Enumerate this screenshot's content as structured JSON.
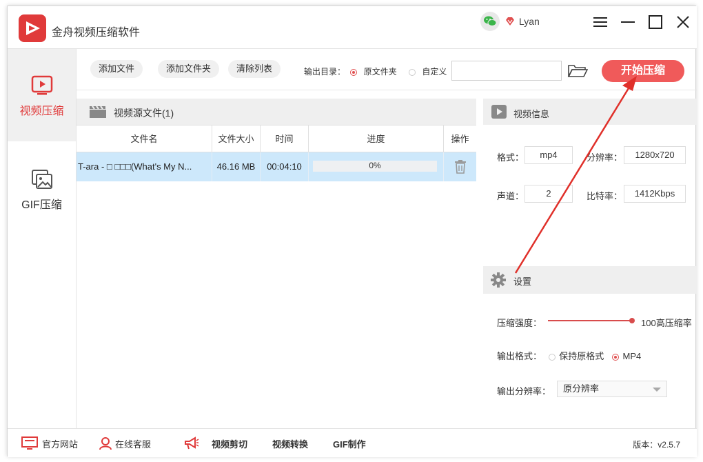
{
  "app": {
    "title": "金舟视频压缩软件",
    "username": "Lyan",
    "accent_color": "#f05a5a",
    "icons": [
      "app-logo-icon",
      "wechat-icon",
      "vip-icon",
      "menu-icon",
      "minimize-icon",
      "maximize-icon",
      "close-icon"
    ]
  },
  "sidebar": {
    "items": [
      {
        "label": "视频压缩",
        "icon": "video-play-icon",
        "active": true
      },
      {
        "label": "GIF压缩",
        "icon": "image-stack-icon",
        "active": false
      }
    ]
  },
  "toolbar": {
    "add_file": "添加文件",
    "add_folder": "添加文件夹",
    "clear_list": "清除列表",
    "output_dir_label": "输出目录：",
    "opt_original": "原文件夹",
    "opt_custom": "自定义",
    "path_value": "",
    "start_label": "开始压缩"
  },
  "source": {
    "title": "视频源文件(1)",
    "columns": [
      "文件名",
      "文件大小",
      "时间",
      "进度",
      "操作"
    ],
    "rows": [
      {
        "name": "T-ara - □ □□□(What's My N...",
        "size": "46.16 MB",
        "duration": "00:04:10",
        "progress": "0%"
      }
    ]
  },
  "info": {
    "title": "视频信息",
    "format_label": "格式：",
    "format_value": "mp4",
    "resolution_label": "分辨率：",
    "resolution_value": "1280x720",
    "channel_label": "声道：",
    "channel_value": "2",
    "bitrate_label": "比特率：",
    "bitrate_value": "1412Kbps"
  },
  "settings": {
    "title": "设置",
    "strength_label": "压缩强度：",
    "strength_value": "100高压缩率",
    "strength_level": 1.0,
    "format_label": "输出格式：",
    "opt_keep": "保持原格式",
    "opt_mp4": "MP4",
    "resolution_label": "输出分辨率：",
    "resolution_selected": "原分辨率"
  },
  "bottom": {
    "official_site": "官方网站",
    "online_service": "在线客服",
    "video_cut": "视频剪切",
    "video_convert": "视频转换",
    "gif_make": "GIF制作",
    "version": "版本：v2.5.7"
  }
}
